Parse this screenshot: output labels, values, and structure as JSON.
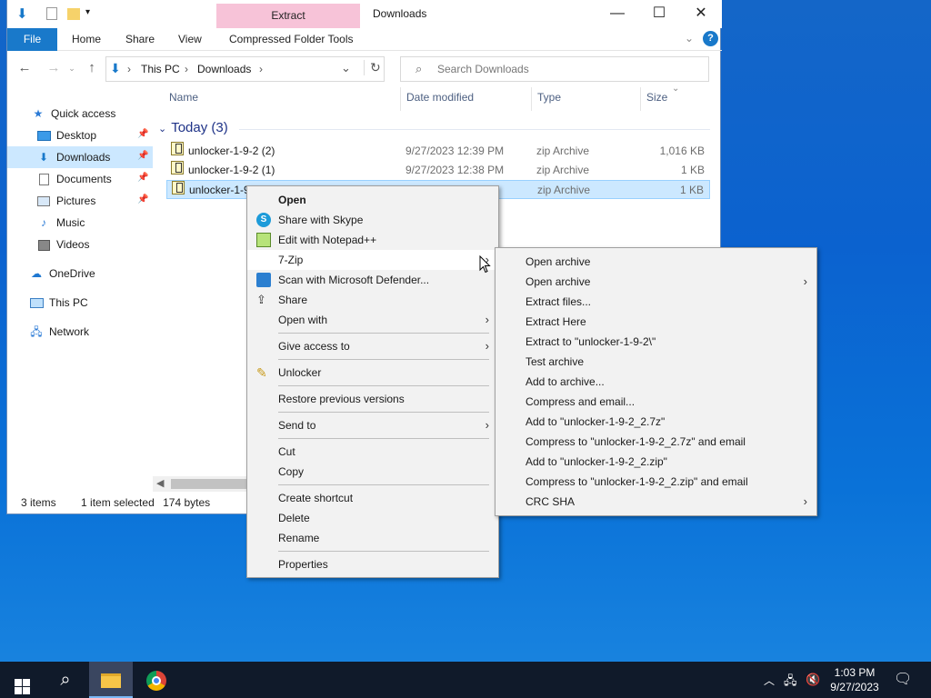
{
  "window": {
    "context_tab": "Extract",
    "title": "Downloads",
    "minimize": "—",
    "maximize": "☐",
    "close": "✕"
  },
  "ribbon": {
    "tabs": [
      "File",
      "Home",
      "Share",
      "View",
      "Compressed Folder Tools"
    ]
  },
  "address": {
    "crumbs": [
      "This PC",
      "Downloads"
    ],
    "search_placeholder": "Search Downloads"
  },
  "nav_pane": {
    "items": [
      {
        "label": "Quick access"
      },
      {
        "label": "Desktop"
      },
      {
        "label": "Downloads"
      },
      {
        "label": "Documents"
      },
      {
        "label": "Pictures"
      },
      {
        "label": "Music"
      },
      {
        "label": "Videos"
      },
      {
        "label": "OneDrive"
      },
      {
        "label": "This PC"
      },
      {
        "label": "Network"
      }
    ]
  },
  "columns": {
    "name": "Name",
    "date": "Date modified",
    "type": "Type",
    "size": "Size"
  },
  "group": {
    "label": "Today (3)"
  },
  "files": [
    {
      "name": "unlocker-1-9-2 (2)",
      "date": "9/27/2023 12:39 PM",
      "type": "zip Archive",
      "size": "1,016 KB"
    },
    {
      "name": "unlocker-1-9-2 (1)",
      "date": "9/27/2023 12:38 PM",
      "type": "zip Archive",
      "size": "1 KB"
    },
    {
      "name": "unlocker-1-9",
      "date": "",
      "type": "zip Archive",
      "size": "1 KB"
    }
  ],
  "status": {
    "count": "3 items",
    "selected": "1 item selected",
    "bytes": "174 bytes"
  },
  "context_menu": {
    "items": [
      "Open",
      "Share with Skype",
      "Edit with Notepad++",
      "7-Zip",
      "Scan with Microsoft Defender...",
      "Share",
      "Open with",
      "Give access to",
      "Unlocker",
      "Restore previous versions",
      "Send to",
      "Cut",
      "Copy",
      "Create shortcut",
      "Delete",
      "Rename",
      "Properties"
    ]
  },
  "submenu": {
    "items": [
      "Open archive",
      "Open archive",
      "Extract files...",
      "Extract Here",
      "Extract to \"unlocker-1-9-2\\\"",
      "Test archive",
      "Add to archive...",
      "Compress and email...",
      "Add to \"unlocker-1-9-2_2.7z\"",
      "Compress to \"unlocker-1-9-2_2.7z\" and email",
      "Add to \"unlocker-1-9-2_2.zip\"",
      "Compress to \"unlocker-1-9-2_2.zip\" and email",
      "CRC SHA"
    ]
  },
  "taskbar": {
    "time": "1:03 PM",
    "date": "9/27/2023"
  },
  "colors": {
    "accent": "#1979ca",
    "selection": "#cce8ff",
    "context_tab": "#f7c3d8",
    "taskbar": "#101a2a"
  }
}
